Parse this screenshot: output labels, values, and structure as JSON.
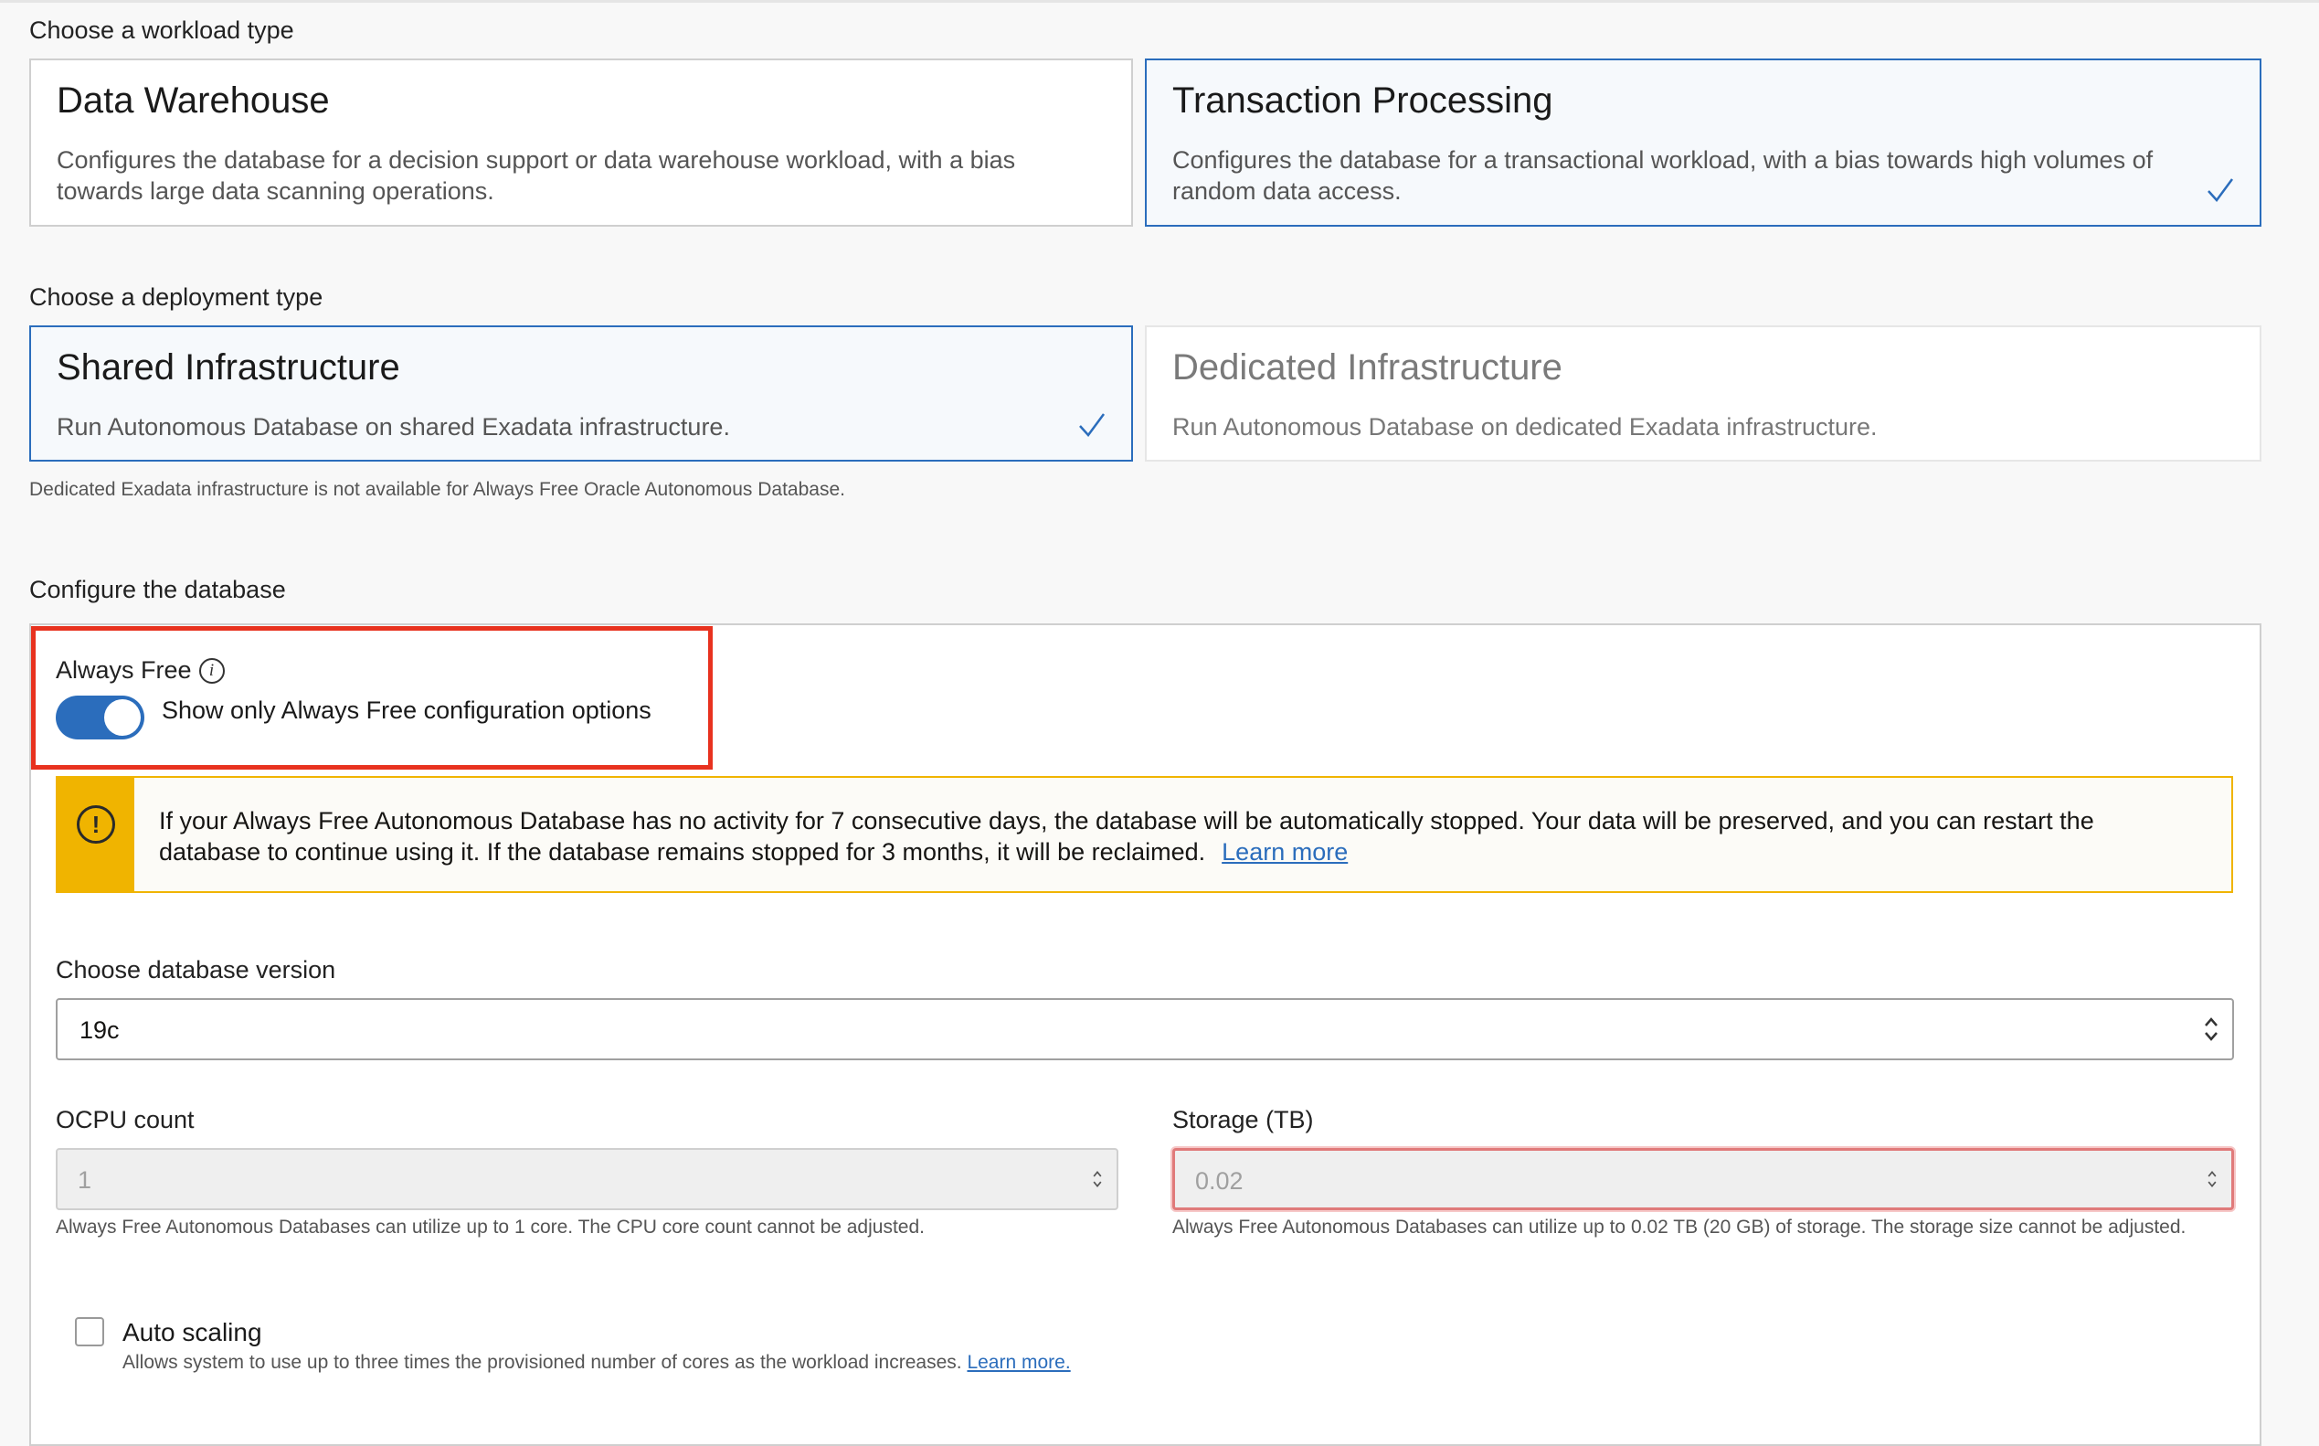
{
  "workload": {
    "section_label": "Choose a workload type",
    "options": [
      {
        "title": "Data Warehouse",
        "description": "Configures the database for a decision support or data warehouse workload, with a bias towards large data scanning operations.",
        "selected": false
      },
      {
        "title": "Transaction Processing",
        "description": "Configures the database for a transactional workload, with a bias towards high volumes of random data access.",
        "selected": true
      }
    ]
  },
  "deployment": {
    "section_label": "Choose a deployment type",
    "options": [
      {
        "title": "Shared Infrastructure",
        "description": "Run Autonomous Database on shared Exadata infrastructure.",
        "selected": true
      },
      {
        "title": "Dedicated Infrastructure",
        "description": "Run Autonomous Database on dedicated Exadata infrastructure.",
        "selected": false,
        "disabled": true
      }
    ],
    "note": "Dedicated Exadata infrastructure is not available for Always Free Oracle Autonomous Database."
  },
  "configure": {
    "section_label": "Configure the database",
    "always_free": {
      "label": "Always Free",
      "info_icon": "info-icon",
      "toggle_label": "Show only Always Free configuration options",
      "enabled": true
    },
    "warning": {
      "icon": "exclamation-circle-icon",
      "text": "If your Always Free Autonomous Database has no activity for 7 consecutive days, the database will be automatically stopped. Your data will be preserved, and you can restart the database to continue using it. If the database remains stopped for 3 months, it will be reclaimed.",
      "link": "Learn more"
    },
    "db_version": {
      "label": "Choose database version",
      "value": "19c"
    },
    "ocpu": {
      "label": "OCPU count",
      "value": "1",
      "hint": "Always Free Autonomous Databases can utilize up to 1 core. The CPU core count cannot be adjusted."
    },
    "storage": {
      "label": "Storage (TB)",
      "value": "0.02",
      "hint": "Always Free Autonomous Databases can utilize up to 0.02 TB (20 GB) of storage. The storage size cannot be adjusted."
    },
    "auto_scaling": {
      "label": "Auto scaling",
      "hint": "Allows system to use up to three times the provisioned number of cores as the workload increases.",
      "link": "Learn more.",
      "checked": false
    }
  },
  "colors": {
    "accent": "#2b6dbc",
    "highlight": "#e8321f",
    "warning": "#f0b400"
  }
}
